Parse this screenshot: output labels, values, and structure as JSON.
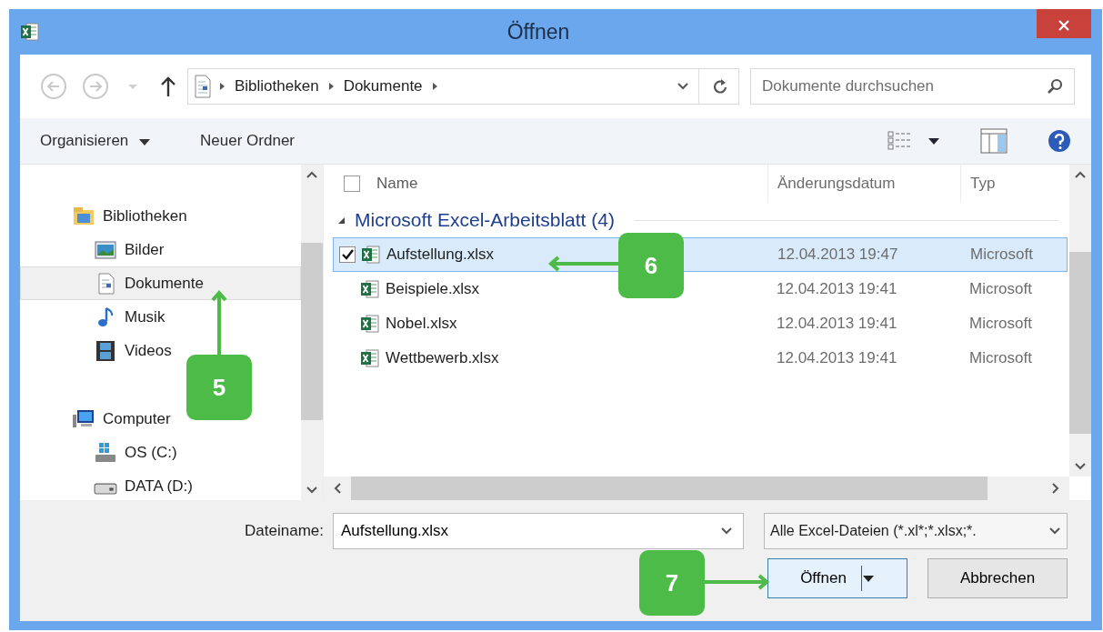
{
  "window": {
    "title": "Öffnen"
  },
  "address_bar": {
    "breadcrumbs": [
      "Bibliotheken",
      "Dokumente"
    ]
  },
  "search": {
    "placeholder": "Dokumente durchsuchen"
  },
  "toolbar": {
    "buttons": [
      "Organisieren",
      "Neuer Ordner"
    ]
  },
  "navigation": [
    {
      "label": "Bibliotheken",
      "kind": "library",
      "selected": false,
      "children": [
        {
          "label": "Bilder",
          "kind": "pictures",
          "selected": false
        },
        {
          "label": "Dokumente",
          "kind": "documents",
          "selected": true
        },
        {
          "label": "Musik",
          "kind": "music",
          "selected": false
        },
        {
          "label": "Videos",
          "kind": "videos",
          "selected": false
        }
      ]
    },
    {
      "label": "Computer",
      "kind": "computer",
      "selected": false,
      "children": [
        {
          "label": "OS (C:)",
          "kind": "system-drive",
          "selected": false
        },
        {
          "label": "DATA (D:)",
          "kind": "drive",
          "selected": false
        }
      ]
    }
  ],
  "file_list": {
    "columns": [
      "Name",
      "Änderungsdatum",
      "Typ"
    ],
    "select_all_checked": false,
    "group": {
      "label": "Microsoft Excel-Arbeitsblatt (4)",
      "expanded": true
    },
    "rows": [
      {
        "name": "Aufstellung.xlsx",
        "modified": "12.04.2013 19:47",
        "type": "Microsoft",
        "selected": true,
        "checked": true
      },
      {
        "name": "Beispiele.xlsx",
        "modified": "12.04.2013 19:41",
        "type": "Microsoft",
        "selected": false,
        "checked": false
      },
      {
        "name": "Nobel.xlsx",
        "modified": "12.04.2013 19:41",
        "type": "Microsoft",
        "selected": false,
        "checked": false
      },
      {
        "name": "Wettbewerb.xlsx",
        "modified": "12.04.2013 19:41",
        "type": "Microsoft",
        "selected": false,
        "checked": false
      }
    ]
  },
  "file_name": {
    "label": "Dateiname:",
    "value": "Aufstellung.xlsx"
  },
  "file_type": {
    "value": "Alle Excel-Dateien (*.xl*;*.xlsx;*."
  },
  "buttons": [
    {
      "label": "Öffnen",
      "kind": "split"
    },
    {
      "label": "Abbrechen",
      "kind": "plain"
    }
  ],
  "callouts": [
    {
      "label": "5"
    },
    {
      "label": "6"
    },
    {
      "label": "7"
    }
  ]
}
